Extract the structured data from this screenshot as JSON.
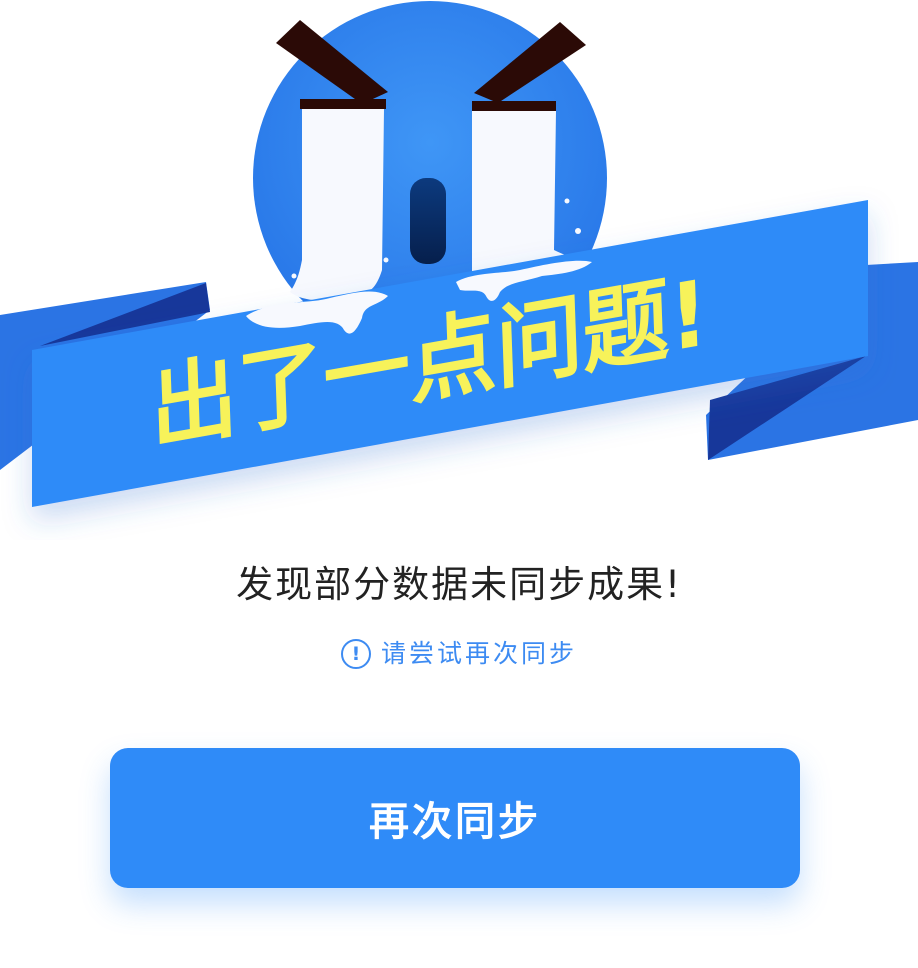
{
  "illustration": {
    "banner_text": "出了一点问题!",
    "face_color": "#2f86f1",
    "banner_color": "#2f8bf8",
    "banner_text_color": "#f7f25a",
    "eyebrow_color": "#2b0a06"
  },
  "message": "发现部分数据未同步成果!",
  "hint": {
    "icon": "exclamation-circle-icon",
    "text": "请尝试再次同步"
  },
  "retry_button": {
    "label": "再次同步",
    "color": "#2f8bf8"
  }
}
